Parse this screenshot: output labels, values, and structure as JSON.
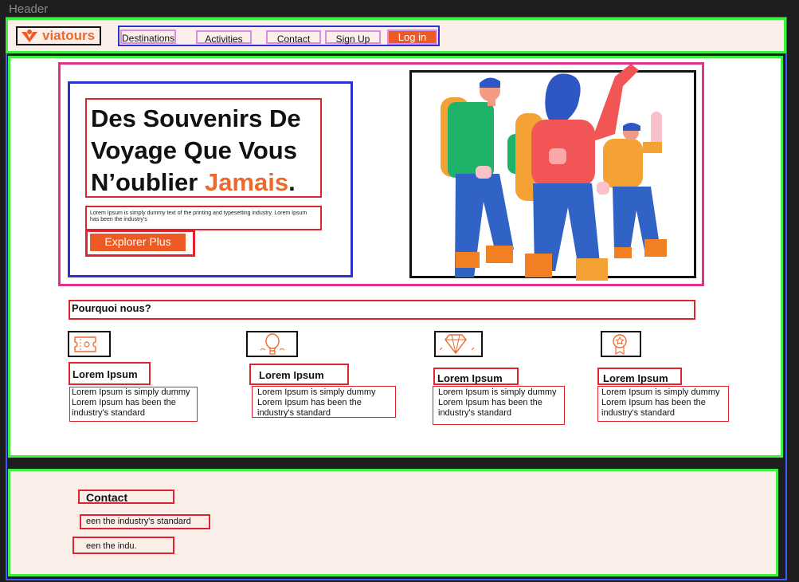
{
  "frame": {
    "label": "Header"
  },
  "header": {
    "logo_text": "viatours",
    "nav": [
      {
        "label": "Destinations"
      },
      {
        "label": "Activities"
      },
      {
        "label": "Contact"
      },
      {
        "label": "Sign Up"
      }
    ],
    "login_label": "Log in"
  },
  "hero": {
    "title_line1": "Des Souvenirs De",
    "title_line2": "Voyage Que Vous",
    "title_line3_prefix": "N’oublier ",
    "title_accent": "Jamais",
    "title_suffix": ".",
    "description": "Lorem Ipsum is simply dummy text of the printing and typesetting industry. Lorem Ipsum has been the industry's",
    "cta_label": "Explorer Plus"
  },
  "why": {
    "title": "Pourquoi nous?"
  },
  "features": [
    {
      "icon": "ticket-icon",
      "title": "Lorem Ipsum",
      "desc": "Lorem Ipsum is simply dummy Lorem Ipsum has been the industry's standard"
    },
    {
      "icon": "hot-air-balloon-icon",
      "title": "Lorem Ipsum",
      "desc": "Lorem Ipsum is simply dummy Lorem Ipsum has been the industry's standard"
    },
    {
      "icon": "diamond-icon",
      "title": "Lorem Ipsum",
      "desc": "Lorem Ipsum is simply dummy Lorem Ipsum has been the industry's standard"
    },
    {
      "icon": "award-badge-icon",
      "title": "Lorem Ipsum",
      "desc": "Lorem Ipsum is simply dummy Lorem Ipsum has been the industry's standard"
    }
  ],
  "footer": {
    "title": "Contact",
    "line1": "een the industry's standard",
    "line2": "een the indu."
  },
  "colors": {
    "accent": "#ee5a24",
    "header_bg": "#fcefe9",
    "frame_green": "#3ef03e"
  }
}
